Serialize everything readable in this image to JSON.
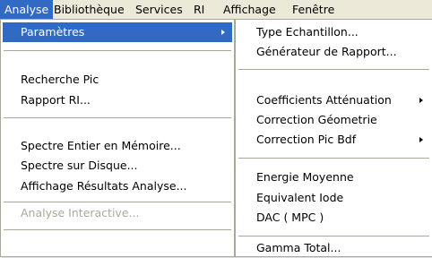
{
  "menubar": {
    "items": [
      {
        "label": "Analyse",
        "active": true
      },
      {
        "label": "Bibliothèque"
      },
      {
        "label": "Services"
      },
      {
        "label": "RI"
      },
      {
        "label": "Affichage"
      },
      {
        "label": "Fenêtre"
      }
    ]
  },
  "analyse_menu": {
    "items": [
      {
        "label": "Paramètres",
        "submenu": true,
        "highlighted": true
      },
      {
        "label": "Recherche Pic"
      },
      {
        "label": "Rapport RI..."
      },
      {
        "label": "Spectre Entier en Mémoire..."
      },
      {
        "label": "Spectre sur Disque..."
      },
      {
        "label": "Affichage Résultats Analyse..."
      },
      {
        "label": "Analyse Interactive...",
        "disabled": true
      }
    ]
  },
  "parametres_submenu": {
    "items": [
      {
        "label": "Type Echantillon..."
      },
      {
        "label": "Générateur de Rapport..."
      },
      {
        "label": "Coefficients Atténuation",
        "submenu": true
      },
      {
        "label": "Correction Géometrie"
      },
      {
        "label": "Correction Pic Bdf",
        "submenu": true
      },
      {
        "label": "Energie Moyenne"
      },
      {
        "label": "Equivalent Iode"
      },
      {
        "label": "DAC ( MPC )"
      },
      {
        "label": "Gamma Total..."
      }
    ]
  },
  "colors": {
    "menubar_bg": "#ece9d8",
    "highlight": "#316ac5",
    "disabled_text": "#aca899"
  }
}
